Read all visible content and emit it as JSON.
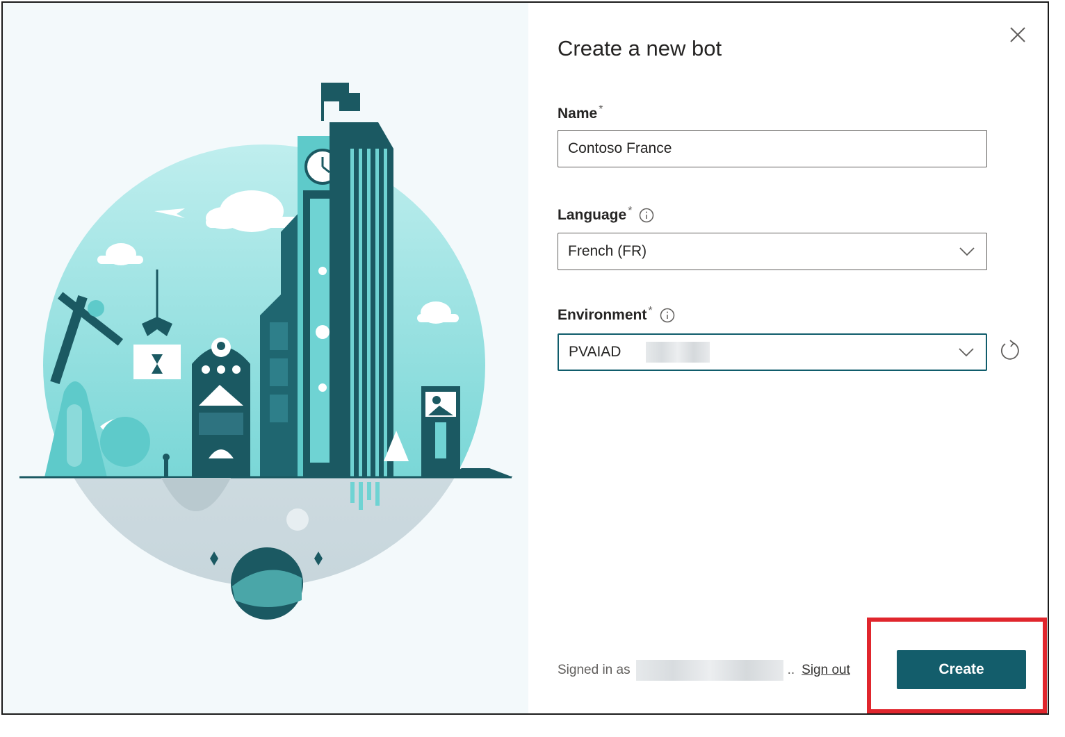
{
  "dialog": {
    "title": "Create a new bot"
  },
  "form": {
    "name": {
      "label": "Name",
      "required_mark": "*",
      "value": "Contoso France"
    },
    "language": {
      "label": "Language",
      "required_mark": "*",
      "value": "French (FR)"
    },
    "environment": {
      "label": "Environment",
      "required_mark": "*",
      "value": "PVAIAD"
    }
  },
  "footer": {
    "signed_in_prefix": "Signed in as",
    "ellipsis": "..",
    "sign_out": "Sign out",
    "create_label": "Create"
  },
  "icons": {
    "close": "close-icon",
    "info": "info-icon",
    "chevron": "chevron-down-icon",
    "refresh": "refresh-icon"
  },
  "colors": {
    "accent": "#135d6b",
    "highlight": "#e0262d",
    "illustration_teal": "#6fd3d3",
    "illustration_dark": "#1b5962"
  }
}
